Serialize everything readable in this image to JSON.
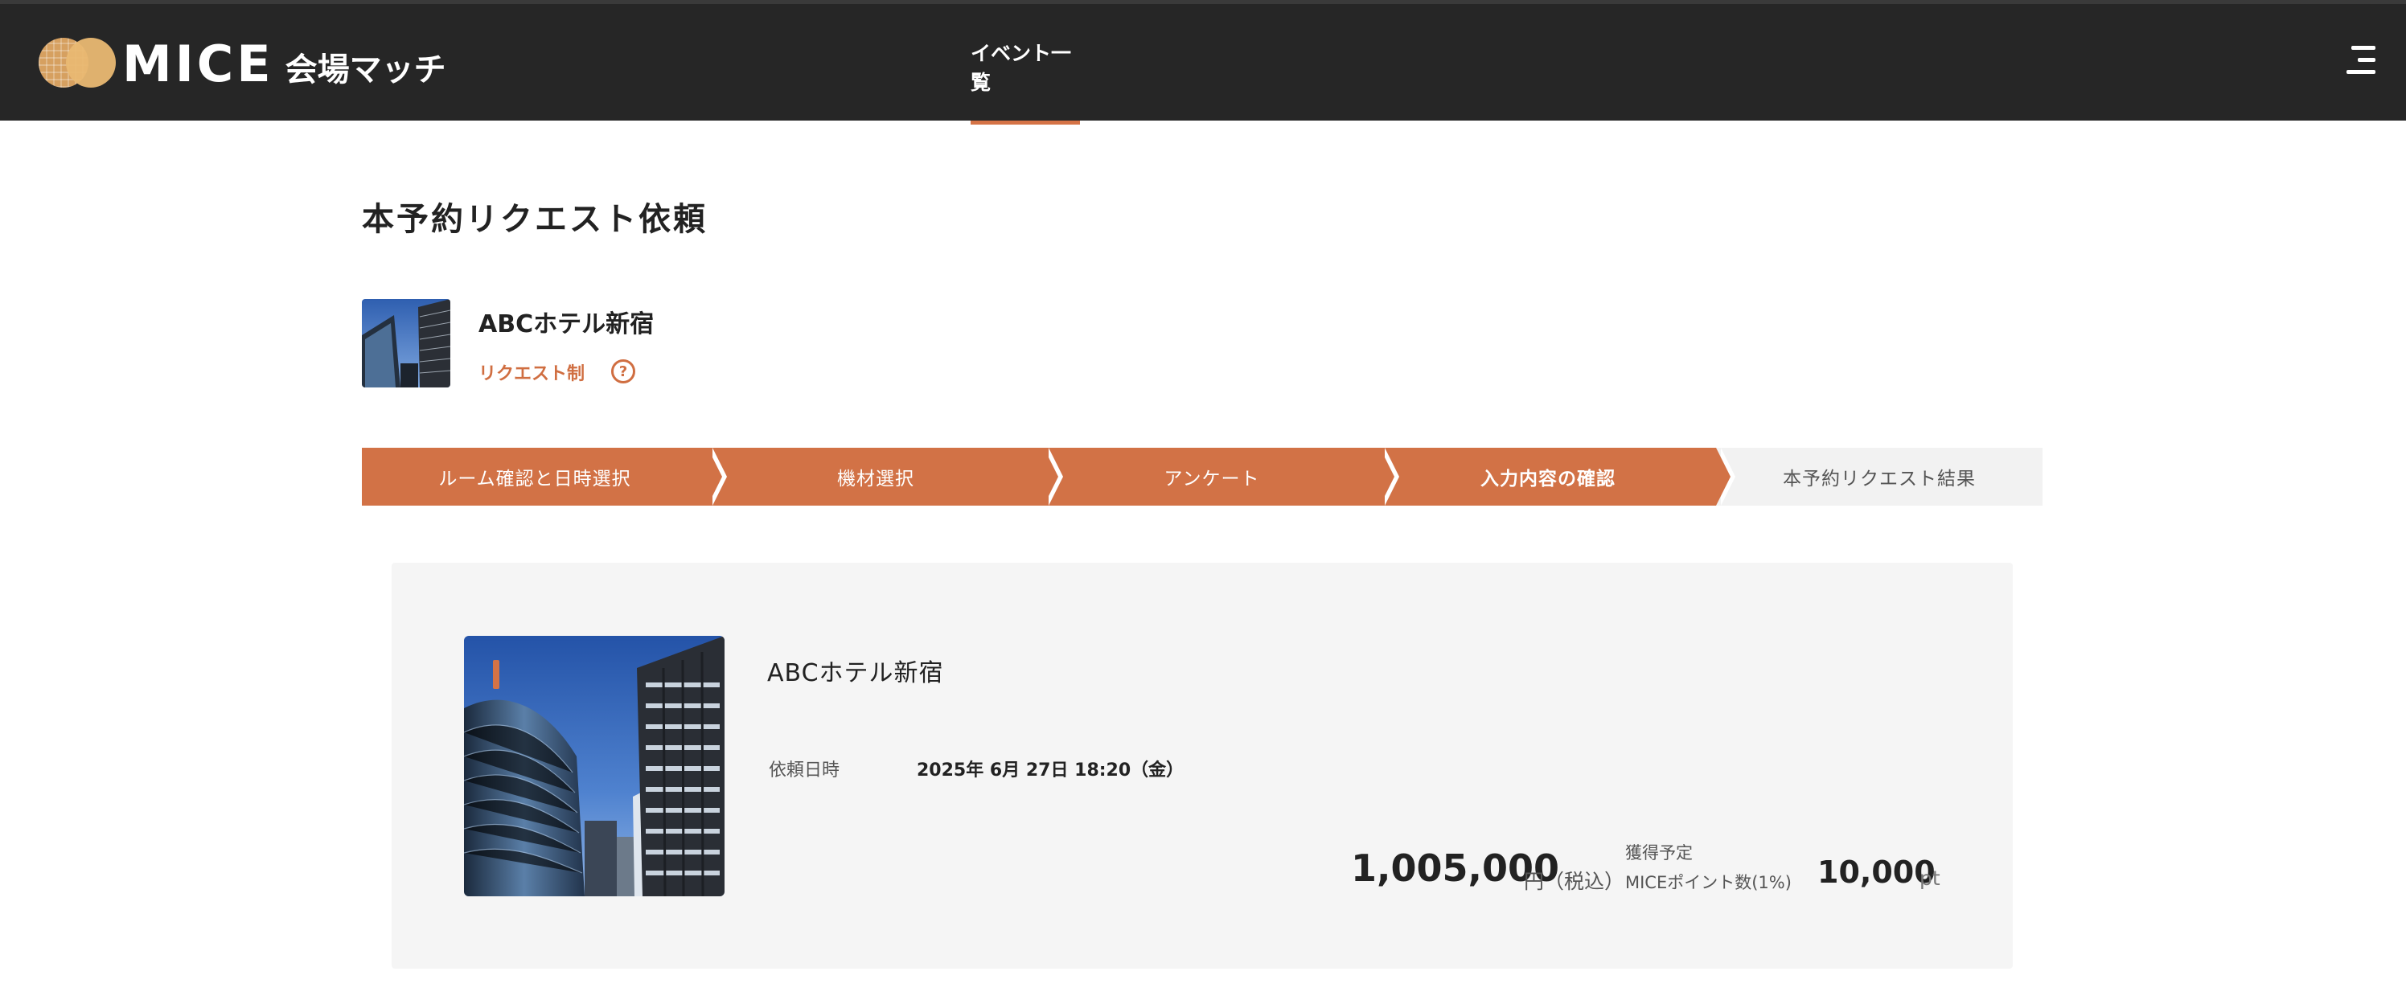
{
  "header": {
    "logo_text": "MICE",
    "logo_sub": "会場マッチ",
    "nav_tab_label": "イベント一覧",
    "menu_icon": "hamburger-menu-icon"
  },
  "page": {
    "title": "本予約リクエスト依頼"
  },
  "venue": {
    "name": "ABCホテル新宿",
    "request_type": "リクエスト制",
    "help_symbol": "?"
  },
  "steps": [
    {
      "label": "ルーム確認と日時選択",
      "state": "done"
    },
    {
      "label": "機材選択",
      "state": "done"
    },
    {
      "label": "アンケート",
      "state": "done"
    },
    {
      "label": "入力内容の確認",
      "state": "current"
    },
    {
      "label": "本予約リクエスト結果",
      "state": "todo"
    }
  ],
  "summary": {
    "venue_name": "ABCホテル新宿",
    "request_date_label": "依頼日時",
    "request_date_value": "2025年 6月 27日 18:20（金）",
    "price": "1,005,000",
    "price_unit": "円（税込）",
    "points_caption": "獲得予定",
    "points_label": "MICEポイント数(1%)",
    "points_value": "10,000",
    "points_unit": "pt"
  },
  "colors": {
    "header_bg": "#262626",
    "accent": "#d27246",
    "card_bg": "#f5f5f5"
  }
}
